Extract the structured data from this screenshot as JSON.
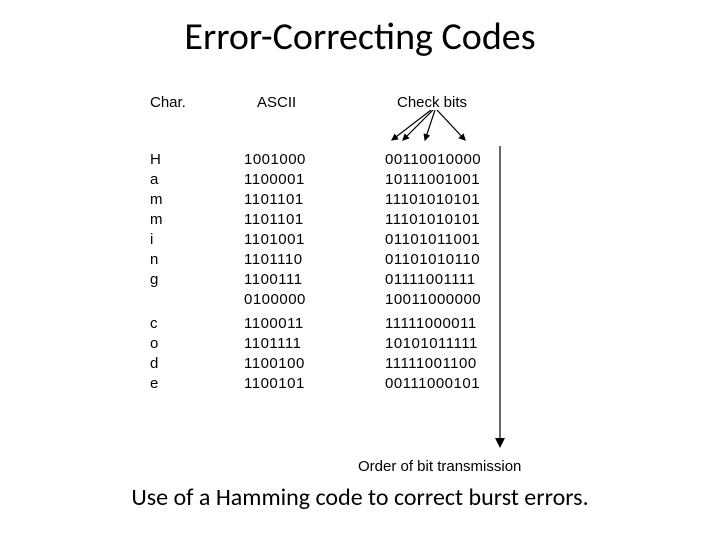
{
  "title": "Error-Correcting Codes",
  "caption": "Use of a Hamming code to correct burst errors.",
  "headers": {
    "char": "Char.",
    "ascii": "ASCII",
    "check": "Check bits"
  },
  "order_label": "Order of bit transmission",
  "rows": [
    {
      "char": "H",
      "ascii": "1001000",
      "check": "00110010000"
    },
    {
      "char": "a",
      "ascii": "1100001",
      "check": "10111001001"
    },
    {
      "char": "m",
      "ascii": "1101101",
      "check": "11101010101"
    },
    {
      "char": "m",
      "ascii": "1101101",
      "check": "11101010101"
    },
    {
      "char": "i",
      "ascii": "1101001",
      "check": "01101011001"
    },
    {
      "char": "n",
      "ascii": "1101110",
      "check": "01101010110"
    },
    {
      "char": "g",
      "ascii": "1100111",
      "check": "01111001111"
    },
    {
      "char": "",
      "ascii": "0100000",
      "check": "10011000000"
    },
    {
      "char": "c",
      "ascii": "1100011",
      "check": "11111000011"
    },
    {
      "char": "o",
      "ascii": "1101111",
      "check": "10101011111"
    },
    {
      "char": "d",
      "ascii": "1100100",
      "check": "11111001100"
    },
    {
      "char": "e",
      "ascii": "1100101",
      "check": "00111000101"
    }
  ]
}
